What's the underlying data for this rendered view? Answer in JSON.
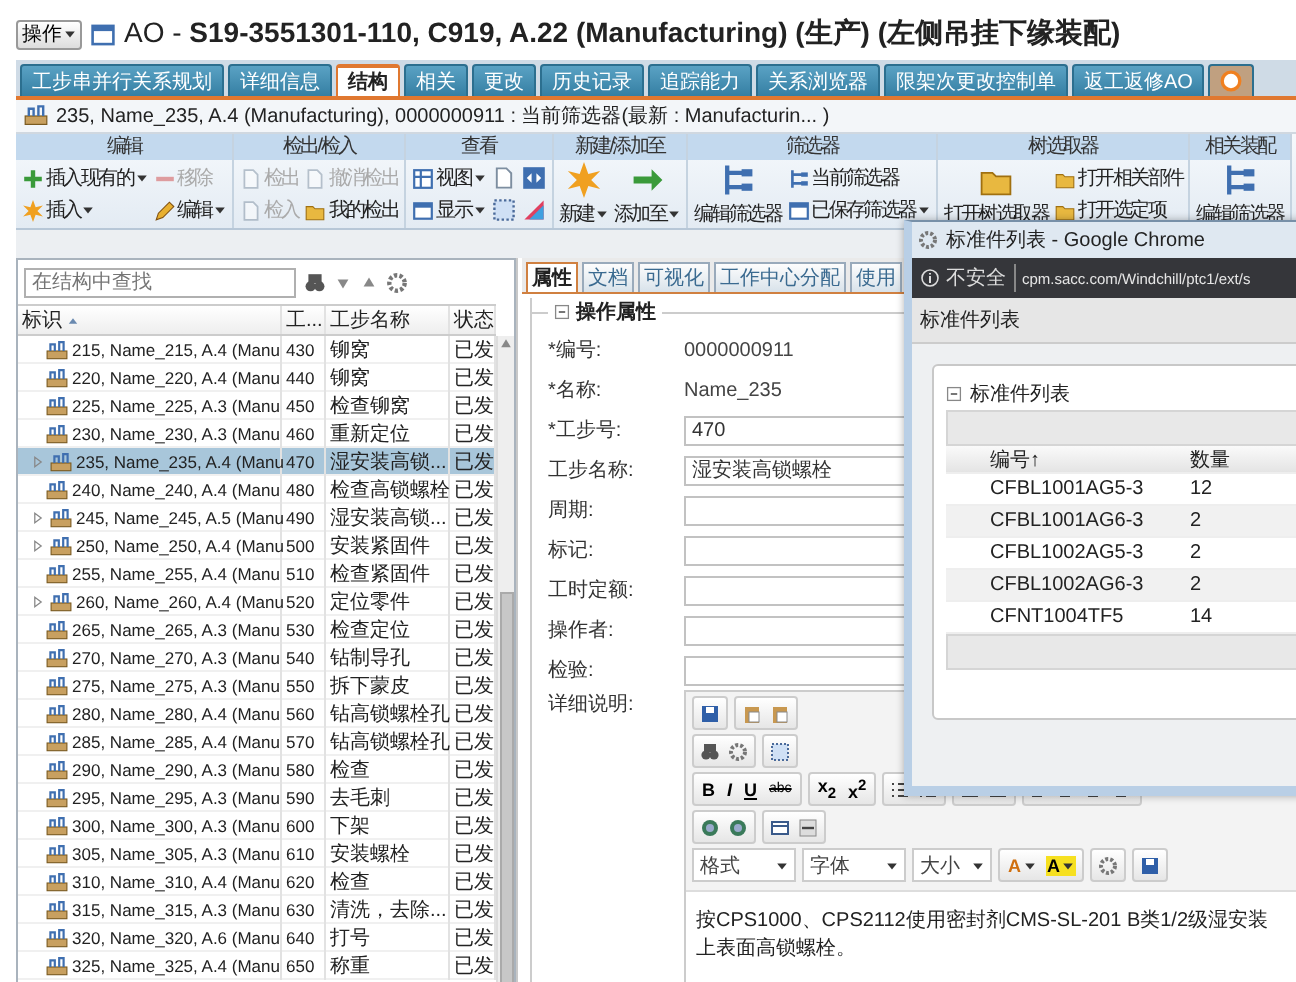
{
  "header": {
    "menu": "操作",
    "title": "AO - **S19-3551301-110, C919, A.22 (Manufacturing) (生产) (左侧吊挂下缘装配)**"
  },
  "tabs": [
    {
      "label": "工步串并行关系规划",
      "selected": false
    },
    {
      "label": "详细信息",
      "selected": false
    },
    {
      "label": "结构",
      "selected": true
    },
    {
      "label": "相关",
      "selected": false
    },
    {
      "label": "更改",
      "selected": false
    },
    {
      "label": "历史记录",
      "selected": false
    },
    {
      "label": "追踪能力",
      "selected": false
    },
    {
      "label": "关系浏览器",
      "selected": false
    },
    {
      "label": "限架次更改控制单",
      "selected": false
    },
    {
      "label": "返工返修AO",
      "selected": false
    }
  ],
  "breadcrumb": "235, Name_235, A.4 (Manufacturing), 0000000911 : 当前筛选器(最新 : Manufacturin... )",
  "ribbon": {
    "groups": [
      {
        "title": "编辑",
        "items": [
          {
            "label": "插入现有的",
            "kind": "small",
            "dropdown": true,
            "disabled": false
          },
          {
            "label": "插入",
            "kind": "small",
            "dropdown": true,
            "disabled": false
          },
          {
            "label": "移除",
            "kind": "small",
            "dropdown": false,
            "disabled": true
          },
          {
            "label": "编辑",
            "kind": "small",
            "dropdown": true,
            "disabled": false
          }
        ]
      },
      {
        "title": "检出/检入",
        "items": [
          {
            "label": "检出",
            "kind": "small",
            "dropdown": false,
            "disabled": true
          },
          {
            "label": "检入",
            "kind": "small",
            "dropdown": false,
            "disabled": true
          },
          {
            "label": "撤消检出",
            "kind": "small",
            "dropdown": false,
            "disabled": true
          },
          {
            "label": "我的检出",
            "kind": "small",
            "dropdown": false,
            "disabled": false
          }
        ]
      },
      {
        "title": "查看",
        "items": [
          {
            "label": "视图",
            "kind": "small",
            "dropdown": true,
            "disabled": false
          },
          {
            "label": "显示",
            "kind": "small",
            "dropdown": true,
            "disabled": false
          },
          {
            "kind": "icon",
            "disabled": false
          },
          {
            "kind": "icon",
            "disabled": false
          },
          {
            "kind": "icon",
            "disabled": false
          },
          {
            "kind": "icon",
            "disabled": false
          }
        ]
      },
      {
        "title": "新建/添加至",
        "items": [
          {
            "label": "新建",
            "kind": "big",
            "dropdown": true,
            "disabled": false
          },
          {
            "label": "添加至",
            "kind": "big",
            "dropdown": true,
            "disabled": false
          }
        ]
      },
      {
        "title": "筛选器",
        "items": [
          {
            "label": "编辑筛选器",
            "kind": "big",
            "dropdown": false,
            "disabled": false
          },
          {
            "label": "当前筛选器",
            "kind": "small",
            "dropdown": false,
            "disabled": false
          },
          {
            "label": "已保存筛选器",
            "kind": "small",
            "dropdown": true,
            "disabled": false
          }
        ]
      },
      {
        "title": "树选取器",
        "items": [
          {
            "label": "打开树选取器",
            "kind": "big",
            "dropdown": false,
            "disabled": false
          },
          {
            "label": "打开相关部件",
            "kind": "small",
            "dropdown": false,
            "disabled": false
          },
          {
            "label": "打开选定项",
            "kind": "small",
            "dropdown": false,
            "disabled": false
          }
        ]
      },
      {
        "title": "相关装配",
        "items": [
          {
            "label": "编辑筛选器",
            "kind": "big",
            "dropdown": false,
            "disabled": false
          }
        ]
      }
    ]
  },
  "tree": {
    "search_placeholder": "在结构中查找",
    "columns": [
      "标识",
      "工...",
      "工步名称",
      "状态"
    ],
    "rows": [
      {
        "label": "215, Name_215, A.4 (Manu",
        "step": "430",
        "name": "铆窝",
        "status": "已发",
        "has_children": false,
        "selected": false
      },
      {
        "label": "220, Name_220, A.4 (Manu",
        "step": "440",
        "name": "铆窝",
        "status": "已发",
        "has_children": false,
        "selected": false
      },
      {
        "label": "225, Name_225, A.3 (Manu",
        "step": "450",
        "name": "检查铆窝",
        "status": "已发",
        "has_children": false,
        "selected": false
      },
      {
        "label": "230, Name_230, A.3 (Manu",
        "step": "460",
        "name": "重新定位",
        "status": "已发",
        "has_children": false,
        "selected": false
      },
      {
        "label": "235, Name_235, A.4 (Manu",
        "step": "470",
        "name": "湿安装高锁...",
        "status": "已发",
        "has_children": true,
        "selected": true
      },
      {
        "label": "240, Name_240, A.4 (Manu",
        "step": "480",
        "name": "检查高锁螺栓",
        "status": "已发",
        "has_children": false,
        "selected": false
      },
      {
        "label": "245, Name_245, A.5 (Manu",
        "step": "490",
        "name": "湿安装高锁...",
        "status": "已发",
        "has_children": true,
        "selected": false
      },
      {
        "label": "250, Name_250, A.4 (Manu",
        "step": "500",
        "name": "安装紧固件",
        "status": "已发",
        "has_children": true,
        "selected": false
      },
      {
        "label": "255, Name_255, A.4 (Manu",
        "step": "510",
        "name": "检查紧固件",
        "status": "已发",
        "has_children": false,
        "selected": false
      },
      {
        "label": "260, Name_260, A.4 (Manu",
        "step": "520",
        "name": "定位零件",
        "status": "已发",
        "has_children": true,
        "selected": false
      },
      {
        "label": "265, Name_265, A.3 (Manu",
        "step": "530",
        "name": "检查定位",
        "status": "已发",
        "has_children": false,
        "selected": false
      },
      {
        "label": "270, Name_270, A.3 (Manu",
        "step": "540",
        "name": "钻制导孔",
        "status": "已发",
        "has_children": false,
        "selected": false
      },
      {
        "label": "275, Name_275, A.3 (Manu",
        "step": "550",
        "name": "拆下蒙皮",
        "status": "已发",
        "has_children": false,
        "selected": false
      },
      {
        "label": "280, Name_280, A.4 (Manu",
        "step": "560",
        "name": "钻高锁螺栓孔",
        "status": "已发",
        "has_children": false,
        "selected": false
      },
      {
        "label": "285, Name_285, A.4 (Manu",
        "step": "570",
        "name": "钻高锁螺栓孔",
        "status": "已发",
        "has_children": false,
        "selected": false
      },
      {
        "label": "290, Name_290, A.3 (Manu",
        "step": "580",
        "name": "检查",
        "status": "已发",
        "has_children": false,
        "selected": false
      },
      {
        "label": "295, Name_295, A.3 (Manu",
        "step": "590",
        "name": "去毛刺",
        "status": "已发",
        "has_children": false,
        "selected": false
      },
      {
        "label": "300, Name_300, A.3 (Manu",
        "step": "600",
        "name": "下架",
        "status": "已发",
        "has_children": false,
        "selected": false
      },
      {
        "label": "305, Name_305, A.3 (Manu",
        "step": "610",
        "name": "安装螺栓",
        "status": "已发",
        "has_children": false,
        "selected": false
      },
      {
        "label": "310, Name_310, A.4 (Manu",
        "step": "620",
        "name": "检查",
        "status": "已发",
        "has_children": false,
        "selected": false
      },
      {
        "label": "315, Name_315, A.3 (Manu",
        "step": "630",
        "name": "清洗，去除...",
        "status": "已发",
        "has_children": false,
        "selected": false
      },
      {
        "label": "320, Name_320, A.6 (Manu",
        "step": "640",
        "name": "打号",
        "status": "已发",
        "has_children": false,
        "selected": false
      },
      {
        "label": "325, Name_325, A.4 (Manu",
        "step": "650",
        "name": "称重",
        "status": "已发",
        "has_children": false,
        "selected": false
      }
    ]
  },
  "details": {
    "tabs": [
      {
        "label": "属性",
        "selected": true
      },
      {
        "label": "文档",
        "selected": false
      },
      {
        "label": "可视化",
        "selected": false
      },
      {
        "label": "工作中心分配",
        "selected": false
      },
      {
        "label": "使用",
        "selected": false
      }
    ],
    "section": {
      "title": "操作属性",
      "expanded": true
    },
    "fields": [
      {
        "label": "*编号:",
        "kind": "text",
        "value": "0000000911"
      },
      {
        "label": "*名称:",
        "kind": "text",
        "value": "Name_235"
      },
      {
        "label": "*工步号:",
        "kind": "input",
        "value": "470"
      },
      {
        "label": "工步名称:",
        "kind": "input",
        "value": "湿安装高锁螺栓"
      },
      {
        "label": "周期:",
        "kind": "input"
      },
      {
        "label": "标记:",
        "kind": "input"
      },
      {
        "label": "工时定额:",
        "kind": "input"
      },
      {
        "label": "操作者:",
        "kind": "input"
      },
      {
        "label": "检验:",
        "kind": "input"
      }
    ],
    "editor": {
      "label": "详细说明:",
      "format_buttons": [
        "B",
        "I",
        "U",
        "abc",
        "x$_{2}$",
        "x$^{2}$"
      ],
      "dropdowns": [
        "格式",
        "字体",
        "大小"
      ],
      "color_buttons": [
        "A",
        "A"
      ],
      "text": "按CPS1000、CPS2112使用密封剂CMS-SL-201 B类1/2级湿安装上表面高锁螺栓。"
    }
  },
  "popup": {
    "title": "标准件列表 - Google Chrome",
    "security": "不安全",
    "url": "cpm.sacc.com/Windchill/ptc1/ext/s",
    "page_title": "标准件列表",
    "panel": {
      "title": "标准件列表",
      "expanded": true,
      "columns": [
        {
          "label": "编号",
          "sort": "↑"
        },
        {
          "label": "数量"
        }
      ],
      "rows": [
        [
          "CFBL1001AG5-3",
          "12"
        ],
        [
          "CFBL1001AG6-3",
          "2"
        ],
        [
          "CFBL1002AG5-3",
          "2"
        ],
        [
          "CFBL1002AG6-3",
          "2"
        ],
        [
          "CFNT1004TF5",
          "14"
        ]
      ]
    }
  }
}
